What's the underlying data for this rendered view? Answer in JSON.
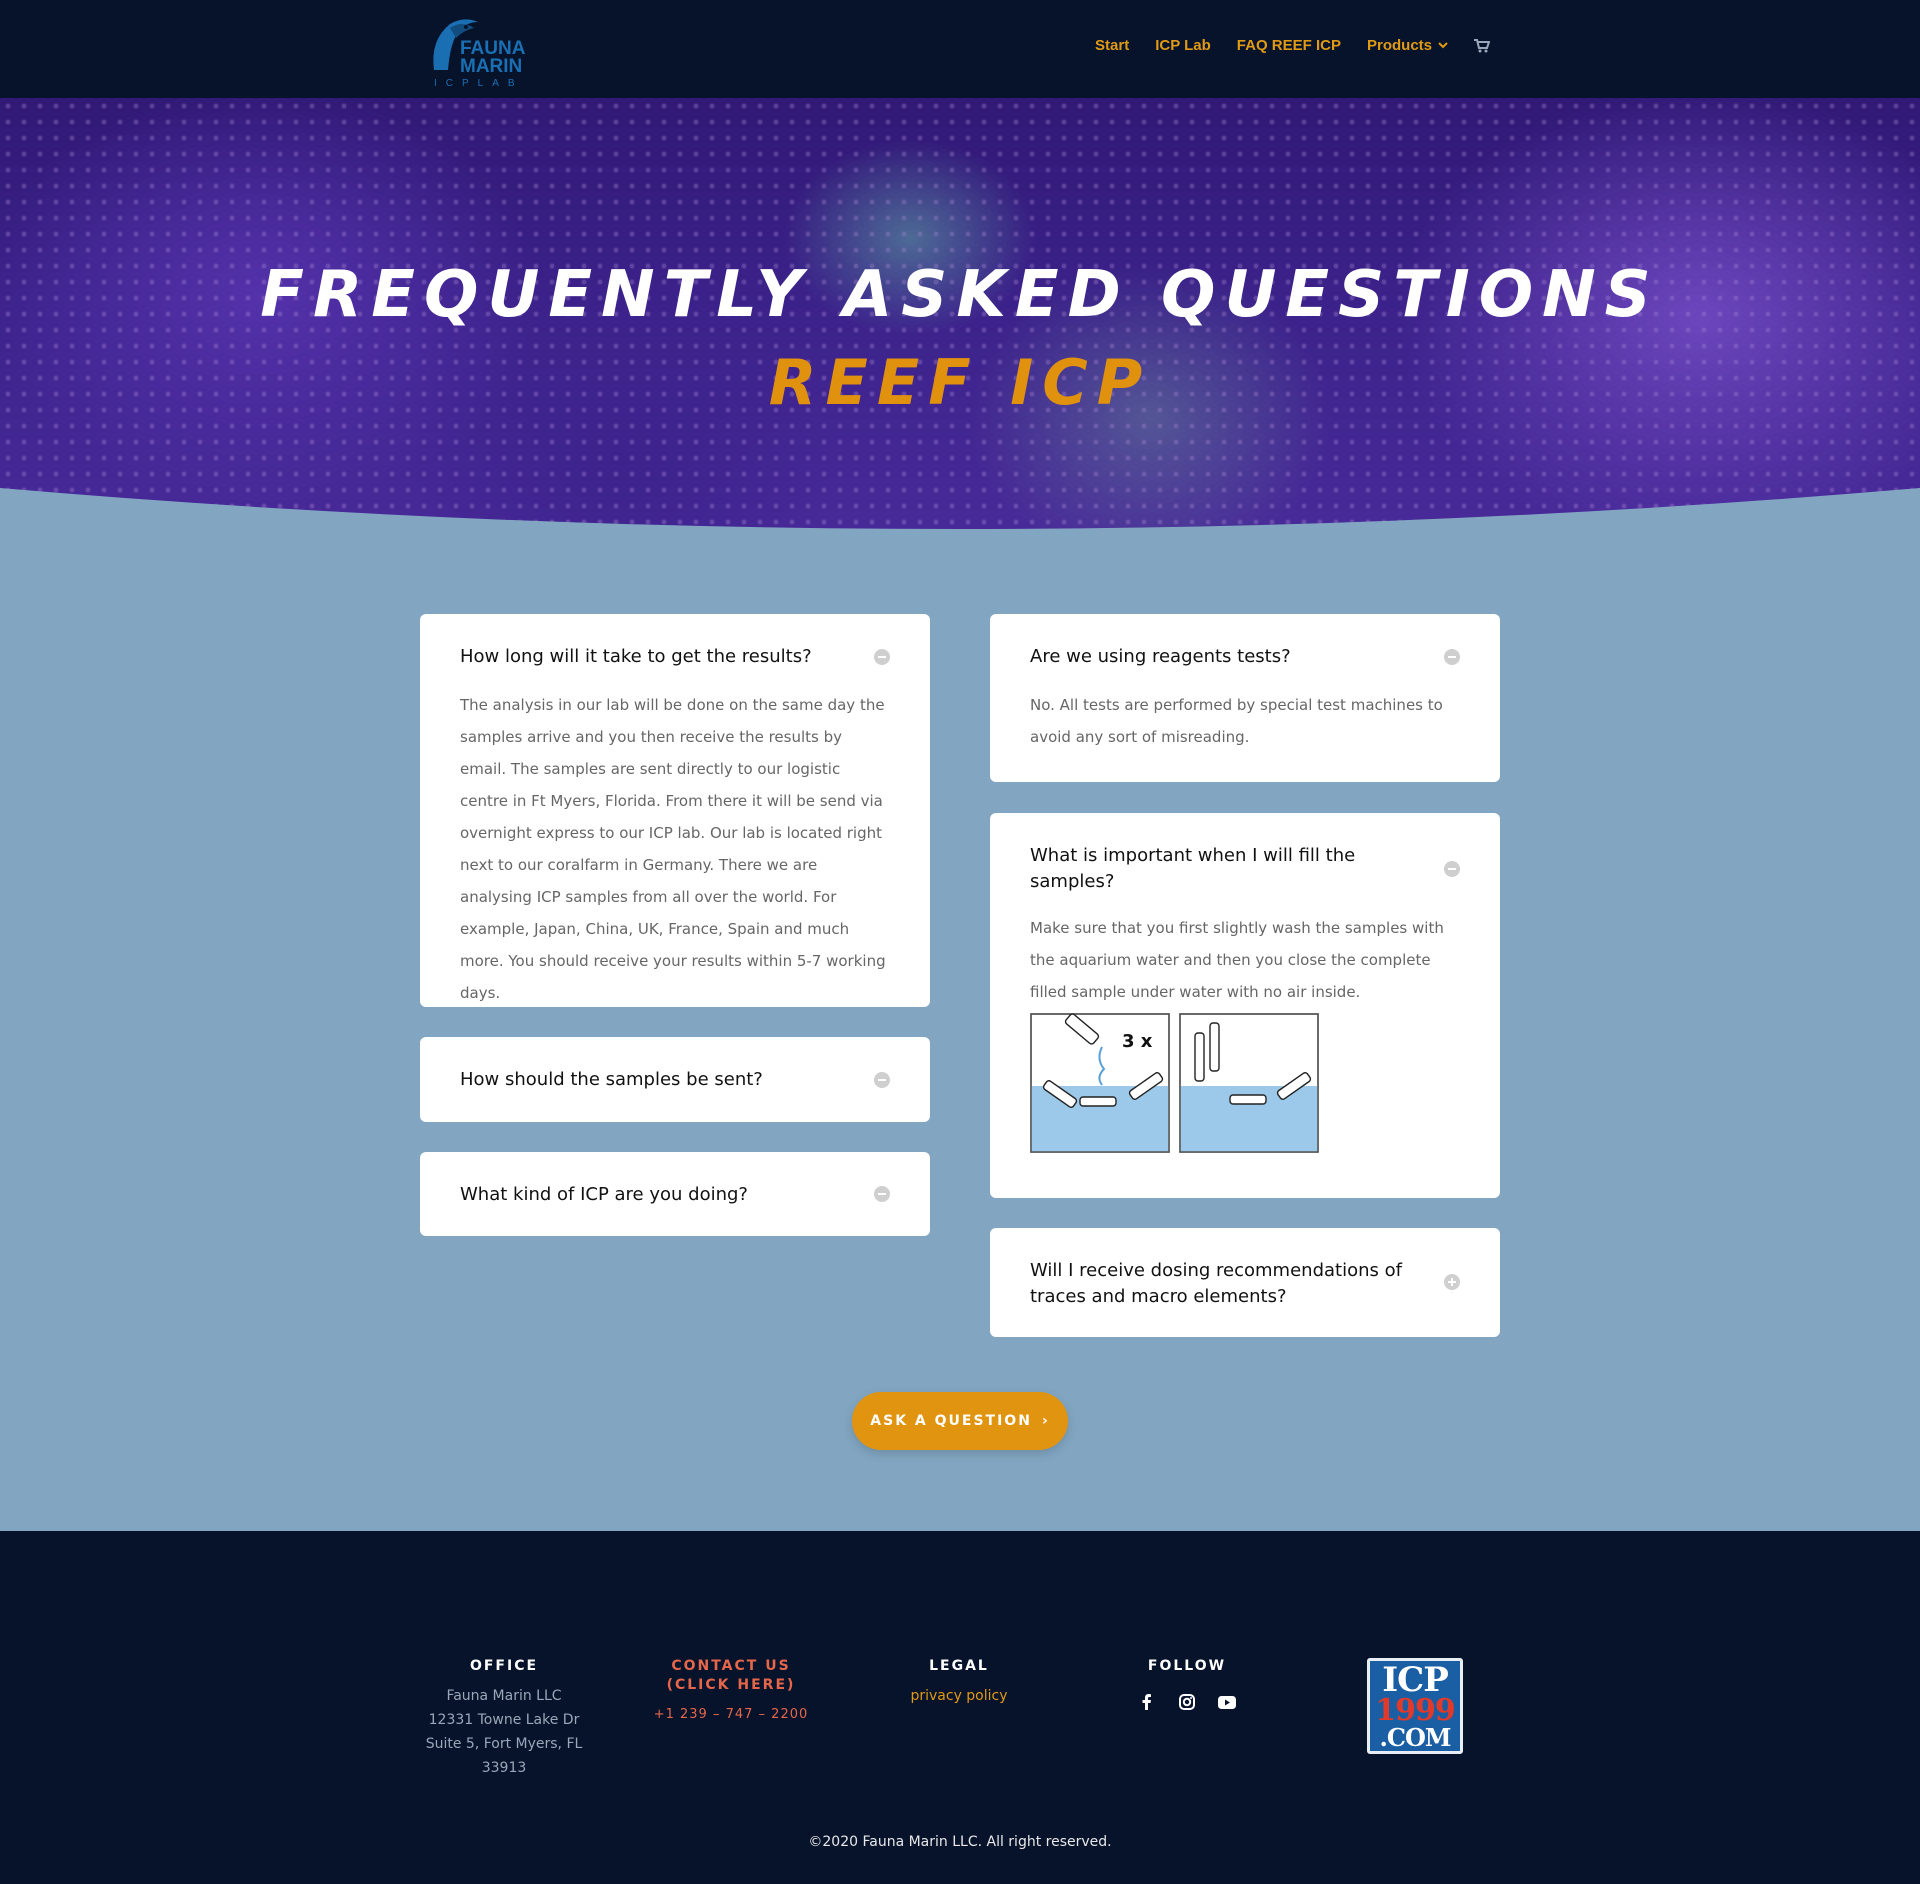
{
  "nav": {
    "logo_alt": "FAUNA MARIN ICP LAB",
    "logo_line1": "FAUNA",
    "logo_line2": "MARIN",
    "logo_line3": "ICPLAB",
    "items": [
      {
        "label": "Start"
      },
      {
        "label": "ICP Lab"
      },
      {
        "label": "FAQ REEF ICP"
      },
      {
        "label": "Products"
      }
    ],
    "cart_icon": "shopping-cart-icon"
  },
  "hero": {
    "title": "FREQUENTLY ASKED QUESTIONS",
    "subtitle": "REEF ICP"
  },
  "faq": {
    "left": [
      {
        "question": "How long will it take to get the results?",
        "answer": "The analysis in our lab will be done on the same day the samples arrive and you then receive the results by email. The samples are sent directly to our logistic centre in Ft Myers, Florida. From there it will be send via overnight express to our ICP lab. Our lab is located right next to our coralfarm in Germany. There we are analysing ICP samples from all over the world. For example, Japan, China, UK, France, Spain and much more. You should receive your results within 5-7 working days.",
        "open": true
      },
      {
        "question": "How should the samples be sent?",
        "open": false
      },
      {
        "question": "What kind of ICP are you doing?",
        "open": false
      }
    ],
    "right": [
      {
        "question": "Are we using reagents tests?",
        "answer": "No. All tests are performed by special test machines to avoid any sort of misreading.",
        "open": true
      },
      {
        "question": "What is important when I will fill the samples?",
        "answer": "Make sure that you first slightly wash the samples with the aquarium water and then you close the complete filled sample under water with no air inside.",
        "diagram_label": "3 x",
        "open": true
      },
      {
        "question": "Will I receive dosing recommendations of traces and macro elements?",
        "open": false
      }
    ]
  },
  "cta": {
    "label": "ASK A QUESTION",
    "arrow": "›"
  },
  "footer": {
    "office": {
      "heading": "OFFICE",
      "lines": [
        "Fauna Marin LLC",
        "12331 Towne Lake Dr",
        "Suite 5, Fort Myers, FL",
        "33913"
      ]
    },
    "contact": {
      "heading_line1": "CONTACT US",
      "heading_line2": "(CLICK HERE)",
      "phone": "+1 239 – 747 – 2200"
    },
    "legal": {
      "heading": "LEGAL",
      "link": "privacy policy"
    },
    "follow": {
      "heading": "FOLLOW",
      "icons": [
        "facebook-icon",
        "instagram-icon",
        "youtube-icon"
      ]
    },
    "badge": {
      "line1": "ICP",
      "line2": "1999",
      "line3": ".COM"
    },
    "copyright": "©2020 Fauna Marin LLC. All right reserved."
  },
  "colors": {
    "accent": "#e09a14",
    "header_bg": "#06132b",
    "section_bg": "#82a6c2"
  }
}
